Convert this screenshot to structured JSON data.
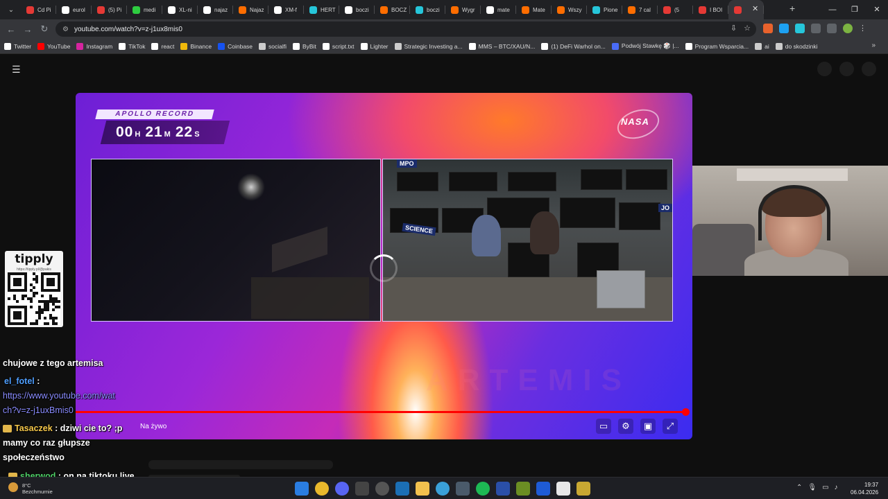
{
  "browser": {
    "tabs": [
      {
        "label": "Cd Pi",
        "color": "#e53935"
      },
      {
        "label": "eurol",
        "color": "#ffffff"
      },
      {
        "label": "(5) Pi",
        "color": "#e53935"
      },
      {
        "label": "medi",
        "color": "#2ecc40"
      },
      {
        "label": "XL-ni",
        "color": "#ffffff"
      },
      {
        "label": "najaz",
        "color": "#ffffff"
      },
      {
        "label": "Najaz",
        "color": "#ff6d00"
      },
      {
        "label": "XM-f",
        "color": "#ffffff"
      },
      {
        "label": "HERT",
        "color": "#26c6da"
      },
      {
        "label": "boczi",
        "color": "#ffffff"
      },
      {
        "label": "BOCZ",
        "color": "#ff6d00"
      },
      {
        "label": "boczi",
        "color": "#26c6da"
      },
      {
        "label": "Wygr",
        "color": "#ff6d00"
      },
      {
        "label": "mate",
        "color": "#ffffff"
      },
      {
        "label": "Mate",
        "color": "#ff6d00"
      },
      {
        "label": "Wszy",
        "color": "#ff6d00"
      },
      {
        "label": "Pione",
        "color": "#26c6da"
      },
      {
        "label": "7 cal",
        "color": "#ff6d00"
      },
      {
        "label": "(5",
        "color": "#e53935"
      },
      {
        "label": "I BOI",
        "color": "#e53935"
      },
      {
        "label": "",
        "color": "#e53935"
      }
    ],
    "url": "youtube.com/watch?v=z-j1ux8mis0",
    "bookmarks": [
      {
        "label": "Twitter",
        "color": "#ffffff"
      },
      {
        "label": "YouTube",
        "color": "#ff0000"
      },
      {
        "label": "Instagram",
        "color": "#d6249f"
      },
      {
        "label": "TikTok",
        "color": "#ffffff"
      },
      {
        "label": "react",
        "color": "#ffffff"
      },
      {
        "label": "Binance",
        "color": "#f0b90b"
      },
      {
        "label": "Coinbase",
        "color": "#1652f0"
      },
      {
        "label": "socialfi",
        "color": "#cccccc"
      },
      {
        "label": "ByBit",
        "color": "#ffffff"
      },
      {
        "label": "script.txt",
        "color": "#ffffff"
      },
      {
        "label": "Lighter",
        "color": "#ffffff"
      },
      {
        "label": "Strategic Investing a...",
        "color": "#cccccc"
      },
      {
        "label": "MMS – BTC/XAU/N...",
        "color": "#ffffff"
      },
      {
        "label": "(1) DeFi Warhol on...",
        "color": "#ffffff"
      },
      {
        "label": "Podwój Stawkę 🎲 |...",
        "color": "#4a6cf7"
      },
      {
        "label": "Program Wsparcia...",
        "color": "#ffffff"
      },
      {
        "label": "ai",
        "color": "#cccccc"
      },
      {
        "label": "do skodzinki",
        "color": "#cccccc"
      }
    ]
  },
  "overlay": {
    "apollo_label": "APOLLO RECORD",
    "timer_h": "00",
    "timer_m": "21",
    "timer_s": "22",
    "unit_h": "H",
    "unit_m": "M",
    "unit_s": "S",
    "nasa": "NASA",
    "science_sign": "SCIENCE",
    "mpo_sign": "MPO",
    "jo_sign": "JO",
    "artemis": "ARTEMIS"
  },
  "player": {
    "live_label": "Na żywo",
    "progress_fraction": 0.995
  },
  "tipply": {
    "logo": "tipply",
    "url": "https://tipply.pl/@pakis"
  },
  "chat": {
    "line1": "chujowe z tego artemisa",
    "user2": "el_fotel",
    "sep": ":",
    "link_a": "https://www.youtube.com/wat",
    "link_b": "ch?v=z-j1uxBmis0",
    "user3": "Tasaczek",
    "msg3a": ": dziwi cie to? ;p",
    "msg3b": "mamy co raz głupsze",
    "msg3c": "społeczeństwo",
    "user4": "sherwod",
    "msg4": ": on na tiktoku live"
  },
  "taskbar": {
    "temp": "8°C",
    "weather": "Bezchmurnie",
    "time": "19:37",
    "date": "06.04.2026"
  }
}
